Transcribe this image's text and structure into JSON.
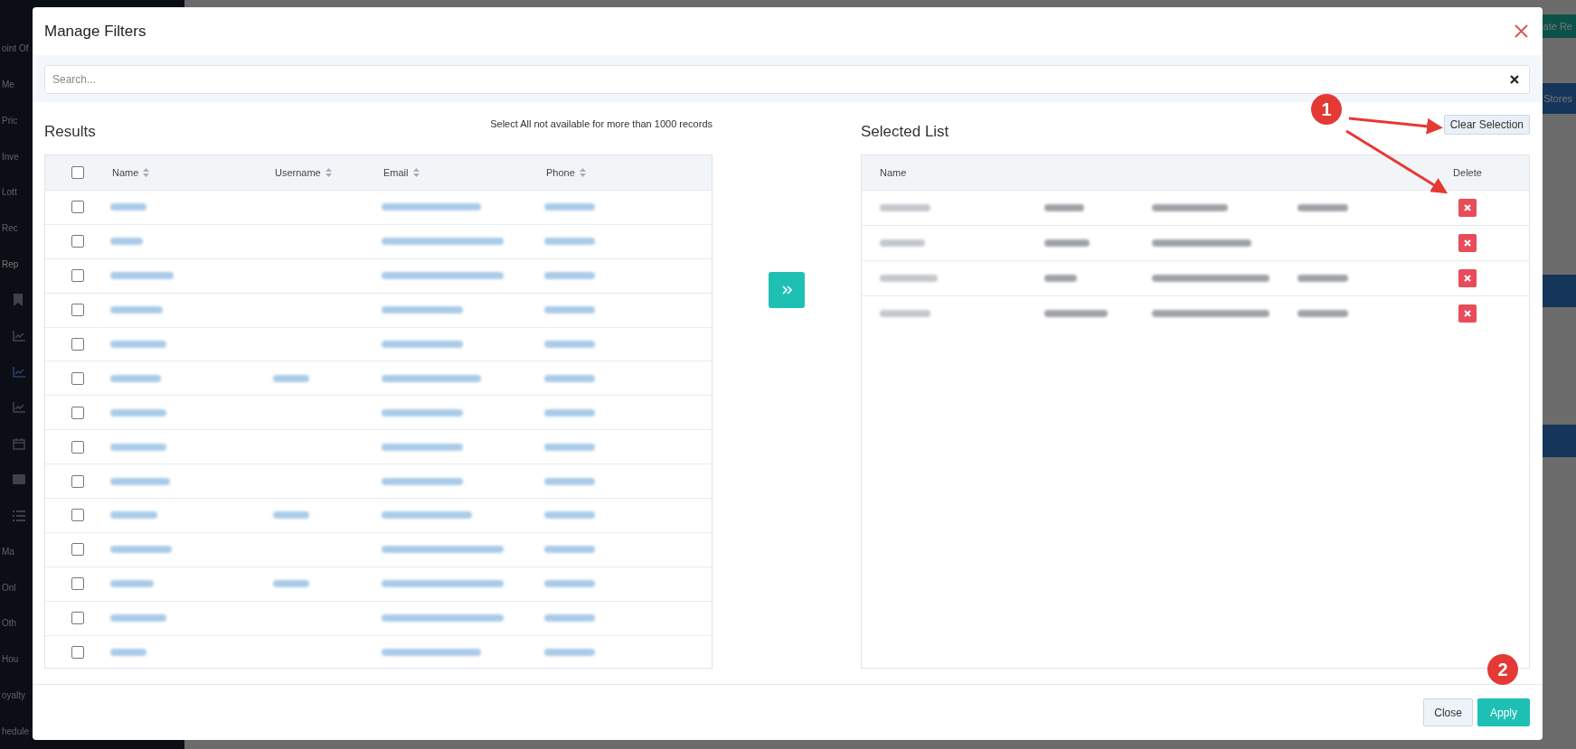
{
  "background": {
    "sidebar_items": [
      {
        "kind": "text",
        "label": "oint Of",
        "selected": false
      },
      {
        "kind": "text",
        "label": "Me",
        "selected": false
      },
      {
        "kind": "text",
        "label": "Pric",
        "selected": false
      },
      {
        "kind": "text",
        "label": "Inve",
        "selected": false
      },
      {
        "kind": "text",
        "label": "Lott",
        "selected": false
      },
      {
        "kind": "text",
        "label": "Rec",
        "selected": false
      },
      {
        "kind": "text",
        "label": "Rep",
        "selected": true
      },
      {
        "kind": "bookmark",
        "selected": false
      },
      {
        "kind": "chart",
        "selected": false
      },
      {
        "kind": "chart",
        "selected": true
      },
      {
        "kind": "chart",
        "selected": false
      },
      {
        "kind": "calendar",
        "selected": false
      },
      {
        "kind": "card",
        "selected": false
      },
      {
        "kind": "list",
        "selected": false
      },
      {
        "kind": "text",
        "label": "Ma",
        "selected": false
      },
      {
        "kind": "text",
        "label": "Onl",
        "selected": false
      },
      {
        "kind": "text",
        "label": "Oth",
        "selected": false
      },
      {
        "kind": "text",
        "label": "Hou",
        "selected": false
      },
      {
        "kind": "text",
        "label": "oyalty",
        "selected": false
      },
      {
        "kind": "text",
        "label": "hedule",
        "selected": false
      }
    ],
    "top_button": "ate Re",
    "band_label": "Stores"
  },
  "modal": {
    "title": "Manage Filters",
    "search": {
      "placeholder": "Search..."
    },
    "results": {
      "title": "Results",
      "note": "Select All not available for more than 1000 records",
      "select_all_checked": false,
      "columns": [
        {
          "label": "Name"
        },
        {
          "label": "Username"
        },
        {
          "label": "Email"
        },
        {
          "label": "Phone"
        }
      ],
      "rows": [
        {
          "checked": false,
          "username_shown": false
        },
        {
          "checked": false,
          "username_shown": false
        },
        {
          "checked": false,
          "username_shown": false
        },
        {
          "checked": false,
          "username_shown": false
        },
        {
          "checked": false,
          "username_shown": false
        },
        {
          "checked": false,
          "username_shown": true
        },
        {
          "checked": false,
          "username_shown": false
        },
        {
          "checked": false,
          "username_shown": false
        },
        {
          "checked": false,
          "username_shown": false
        },
        {
          "checked": false,
          "username_shown": true
        },
        {
          "checked": false,
          "username_shown": false
        },
        {
          "checked": false,
          "username_shown": true
        },
        {
          "checked": false,
          "username_shown": false
        },
        {
          "checked": false,
          "username_shown": false
        }
      ]
    },
    "selected_list": {
      "title": "Selected List",
      "clear_button": "Clear Selection",
      "name_column": "Name",
      "delete_column": "Delete",
      "rows": [
        {
          "phone_shown": true
        },
        {
          "phone_shown": false
        },
        {
          "phone_shown": true
        },
        {
          "phone_shown": true
        }
      ]
    },
    "close_button": "Close",
    "apply_button": "Apply"
  },
  "annotations": [
    {
      "label": "1"
    },
    {
      "label": "2"
    }
  ]
}
